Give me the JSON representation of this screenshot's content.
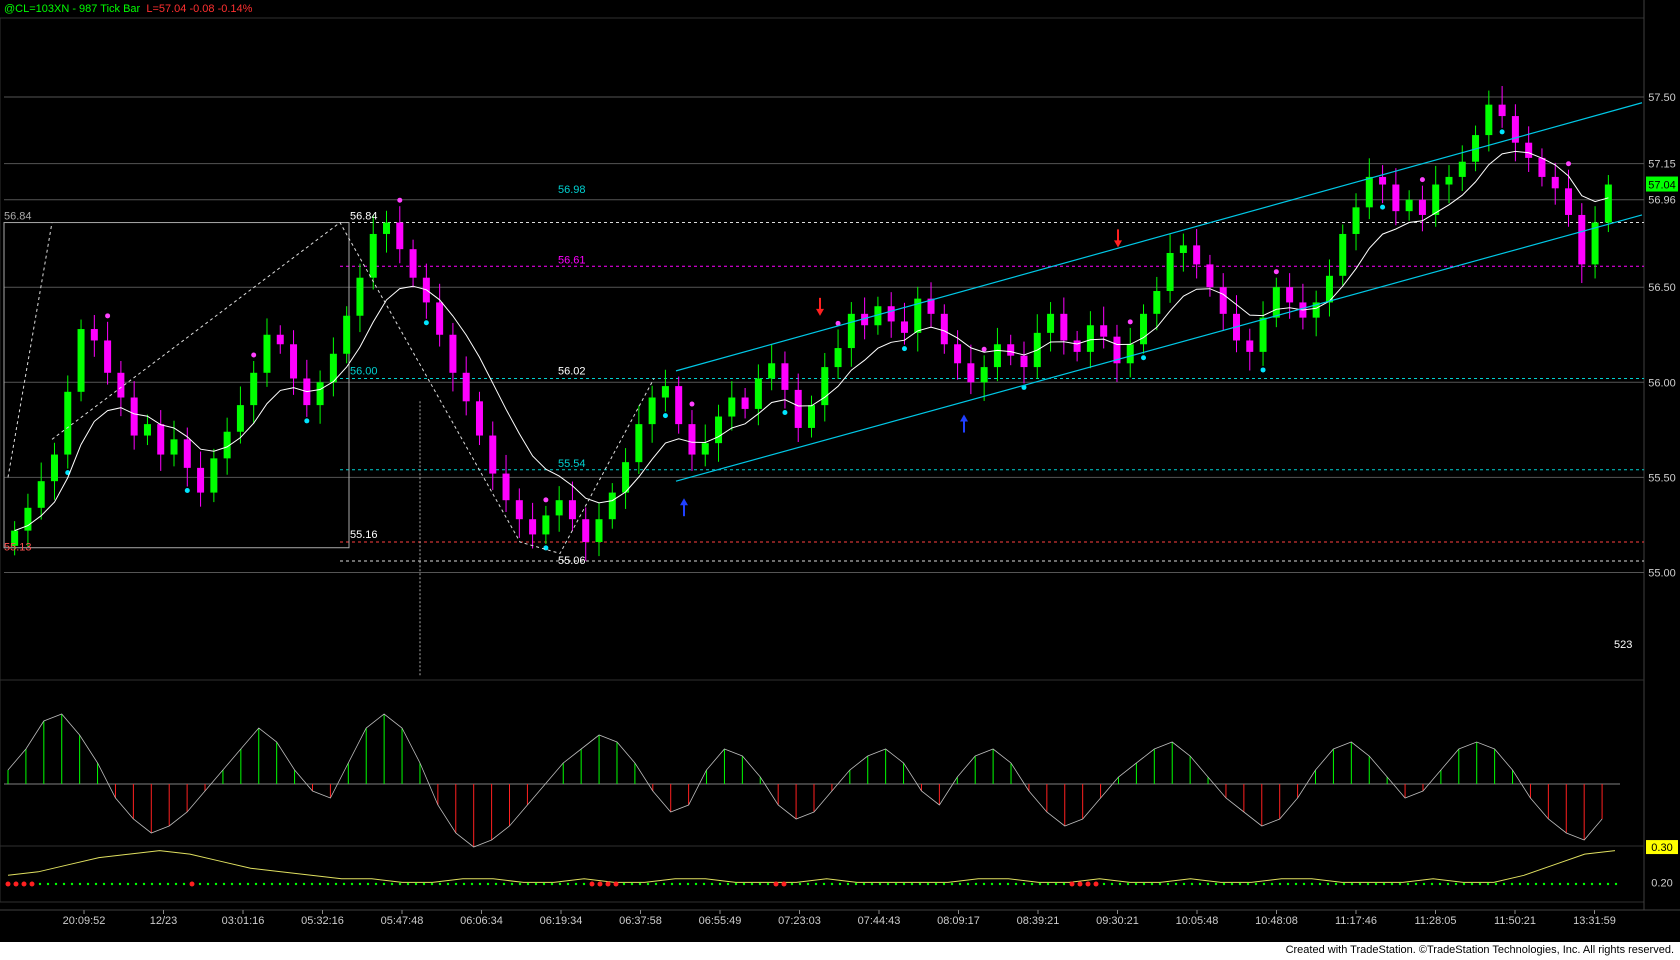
{
  "header": {
    "symbol_line": "@CL=103XN - 987 Tick Bar",
    "quote_line": "L=57.04  -0.08  -0.14%"
  },
  "footer": {
    "text": "Created with TradeStation. ©TradeStation Technologies, Inc. All rights reserved."
  },
  "colors": {
    "background": "#000000",
    "up_candle": "#00ff00",
    "down_candle": "#ff00ff",
    "ma_line": "#ffffff",
    "channel": "#00c8e6",
    "hist_pos": "#00ff00",
    "hist_neg": "#ff2020",
    "level_cyan": "#00d0d0",
    "level_magenta": "#ff00ff",
    "level_grey": "#b0b0b0",
    "level_red": "#ff4040"
  },
  "chart_data": [
    {
      "type": "candlestick",
      "ylim": [
        54.75,
        57.8
      ],
      "y_ticks": [
        "57.50",
        "57.15",
        "57.04",
        "56.96",
        "56.50",
        "56.00",
        "55.50",
        "55.00"
      ],
      "last_price_label": "57.04",
      "x_tick_labels": [
        "20:09:52",
        "12/23",
        "03:01:16",
        "05:32:16",
        "05:47:48",
        "06:06:34",
        "06:19:34",
        "06:37:58",
        "06:55:49",
        "07:23:03",
        "07:44:43",
        "08:09:17",
        "08:39:21",
        "09:30:21",
        "10:05:48",
        "10:48:08",
        "11:17:46",
        "11:28:05",
        "11:50:21",
        "13:31:59"
      ],
      "price_labels": [
        {
          "text": "56.84",
          "color": "grey"
        },
        {
          "text": "56.84",
          "color": "white"
        },
        {
          "text": "55.13",
          "color": "red"
        },
        {
          "text": "55.16",
          "color": "white"
        },
        {
          "text": "56.00",
          "color": "cyan"
        },
        {
          "text": "56.98",
          "color": "cyan"
        },
        {
          "text": "56.61",
          "color": "magenta"
        },
        {
          "text": "56.02",
          "color": "white"
        },
        {
          "text": "55.54",
          "color": "cyan"
        },
        {
          "text": "55.06",
          "color": "white"
        },
        {
          "text": "523",
          "color": "white"
        }
      ],
      "levels": [
        {
          "price": 56.84,
          "style": "dashed",
          "color": "white"
        },
        {
          "price": 56.61,
          "style": "dashed",
          "color": "magenta"
        },
        {
          "price": 56.02,
          "style": "dashed",
          "color": "cyan"
        },
        {
          "price": 55.54,
          "style": "dashed",
          "color": "cyan"
        },
        {
          "price": 55.16,
          "style": "dashed",
          "color": "red"
        },
        {
          "price": 55.06,
          "style": "dashed",
          "color": "white"
        }
      ],
      "close_series": [
        55.22,
        55.34,
        55.48,
        55.62,
        55.95,
        56.28,
        56.22,
        56.05,
        55.92,
        55.72,
        55.78,
        55.62,
        55.7,
        55.55,
        55.42,
        55.6,
        55.74,
        55.88,
        56.05,
        56.25,
        56.2,
        56.02,
        55.88,
        56.0,
        56.15,
        56.35,
        56.55,
        56.78,
        56.84,
        56.7,
        56.55,
        56.42,
        56.25,
        56.05,
        55.9,
        55.72,
        55.52,
        55.38,
        55.28,
        55.2,
        55.3,
        55.38,
        55.28,
        55.16,
        55.28,
        55.42,
        55.58,
        55.78,
        55.92,
        55.98,
        55.78,
        55.62,
        55.68,
        55.82,
        55.92,
        55.86,
        56.02,
        56.1,
        55.96,
        55.76,
        55.88,
        56.08,
        56.18,
        56.36,
        56.3,
        56.4,
        56.32,
        56.26,
        56.44,
        56.36,
        56.2,
        56.1,
        56.0,
        56.08,
        56.2,
        56.14,
        56.08,
        56.26,
        56.36,
        56.22,
        56.16,
        56.3,
        56.24,
        56.1,
        56.2,
        56.36,
        56.48,
        56.68,
        56.72,
        56.62,
        56.5,
        56.36,
        56.22,
        56.16,
        56.34,
        56.5,
        56.42,
        56.34,
        56.42,
        56.56,
        56.78,
        56.92,
        57.08,
        57.04,
        56.9,
        56.96,
        56.88,
        57.04,
        57.08,
        57.16,
        57.3,
        57.46,
        57.4,
        57.26,
        57.18,
        57.08,
        57.02,
        56.88,
        56.62,
        56.84,
        57.04
      ],
      "signal_arrows": [
        {
          "dir": "down",
          "color": "red"
        },
        {
          "dir": "down",
          "color": "red"
        },
        {
          "dir": "up",
          "color": "blue"
        },
        {
          "dir": "up",
          "color": "blue"
        }
      ]
    },
    {
      "type": "histogram",
      "name": "oscillator",
      "values": [
        0.2,
        0.5,
        0.9,
        1.0,
        0.7,
        0.3,
        -0.2,
        -0.5,
        -0.7,
        -0.6,
        -0.4,
        -0.1,
        0.2,
        0.5,
        0.8,
        0.6,
        0.2,
        -0.1,
        -0.2,
        0.3,
        0.8,
        1.0,
        0.8,
        0.3,
        -0.3,
        -0.7,
        -0.9,
        -0.8,
        -0.6,
        -0.3,
        0.0,
        0.3,
        0.5,
        0.7,
        0.6,
        0.3,
        -0.1,
        -0.4,
        -0.3,
        0.2,
        0.5,
        0.4,
        0.1,
        -0.3,
        -0.5,
        -0.4,
        -0.1,
        0.2,
        0.4,
        0.5,
        0.3,
        -0.1,
        -0.3,
        0.1,
        0.4,
        0.5,
        0.3,
        -0.1,
        -0.4,
        -0.6,
        -0.5,
        -0.2,
        0.1,
        0.3,
        0.5,
        0.6,
        0.4,
        0.1,
        -0.2,
        -0.4,
        -0.6,
        -0.5,
        -0.2,
        0.2,
        0.5,
        0.6,
        0.4,
        0.1,
        -0.2,
        -0.1,
        0.2,
        0.5,
        0.6,
        0.5,
        0.2,
        -0.2,
        -0.5,
        -0.7,
        -0.8,
        -0.5
      ]
    },
    {
      "type": "line",
      "name": "lower indicator",
      "y_ticks": [
        "0.30",
        "0.20"
      ],
      "values": [
        0.22,
        0.23,
        0.25,
        0.27,
        0.28,
        0.29,
        0.28,
        0.26,
        0.24,
        0.23,
        0.22,
        0.21,
        0.21,
        0.2,
        0.2,
        0.21,
        0.21,
        0.2,
        0.2,
        0.21,
        0.2,
        0.2,
        0.21,
        0.21,
        0.2,
        0.2,
        0.2,
        0.21,
        0.2,
        0.2,
        0.2,
        0.2,
        0.21,
        0.21,
        0.2,
        0.2,
        0.21,
        0.2,
        0.2,
        0.21,
        0.2,
        0.2,
        0.21,
        0.21,
        0.2,
        0.2,
        0.2,
        0.21,
        0.2,
        0.2,
        0.22,
        0.25,
        0.28,
        0.29
      ]
    }
  ]
}
